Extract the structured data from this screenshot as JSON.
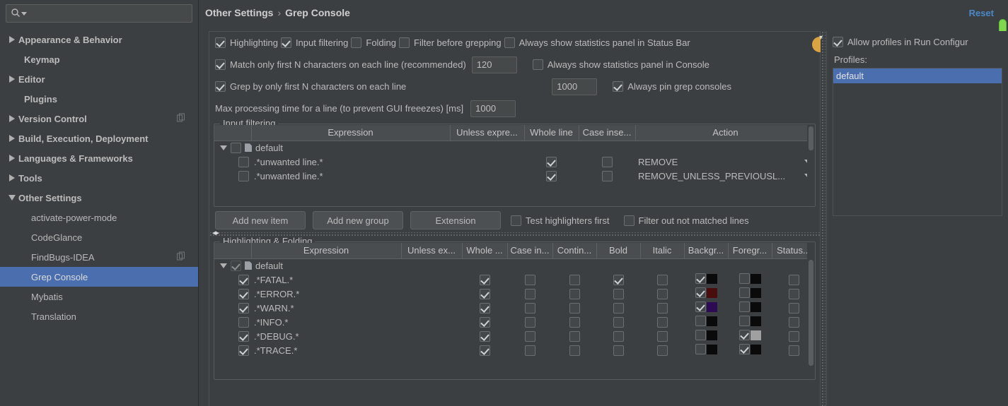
{
  "search": {
    "placeholder": "",
    "value": "",
    "icon": "search-icon"
  },
  "sidebar": {
    "items": [
      {
        "label": "Appearance & Behavior",
        "level": 1,
        "arrow": "collapsed",
        "selected": false,
        "badge": false
      },
      {
        "label": "Keymap",
        "level": 1,
        "arrow": "none",
        "selected": false,
        "badge": false
      },
      {
        "label": "Editor",
        "level": 1,
        "arrow": "collapsed",
        "selected": false,
        "badge": false
      },
      {
        "label": "Plugins",
        "level": 1,
        "arrow": "none",
        "selected": false,
        "badge": false
      },
      {
        "label": "Version Control",
        "level": 1,
        "arrow": "collapsed",
        "selected": false,
        "badge": true
      },
      {
        "label": "Build, Execution, Deployment",
        "level": 1,
        "arrow": "collapsed",
        "selected": false,
        "badge": false
      },
      {
        "label": "Languages & Frameworks",
        "level": 1,
        "arrow": "collapsed",
        "selected": false,
        "badge": false
      },
      {
        "label": "Tools",
        "level": 1,
        "arrow": "collapsed",
        "selected": false,
        "badge": false
      },
      {
        "label": "Other Settings",
        "level": 1,
        "arrow": "expanded",
        "selected": false,
        "badge": false
      },
      {
        "label": "activate-power-mode",
        "level": 2,
        "arrow": "none",
        "selected": false,
        "badge": false
      },
      {
        "label": "CodeGlance",
        "level": 2,
        "arrow": "none",
        "selected": false,
        "badge": false
      },
      {
        "label": "FindBugs-IDEA",
        "level": 2,
        "arrow": "none",
        "selected": false,
        "badge": true
      },
      {
        "label": "Grep Console",
        "level": 2,
        "arrow": "none",
        "selected": true,
        "badge": false
      },
      {
        "label": "Mybatis",
        "level": 2,
        "arrow": "none",
        "selected": false,
        "badge": false
      },
      {
        "label": "Translation",
        "level": 2,
        "arrow": "none",
        "selected": false,
        "badge": false
      }
    ]
  },
  "header": {
    "breadcrumb_parent": "Other Settings",
    "breadcrumb_sep": "›",
    "breadcrumb_current": "Grep Console",
    "reset_label": "Reset"
  },
  "options": {
    "row1": [
      {
        "label": "Highlighting",
        "checked": true
      },
      {
        "label": "Input filtering",
        "checked": true
      },
      {
        "label": "Folding",
        "checked": false
      },
      {
        "label": "Filter before grepping",
        "checked": false
      },
      {
        "label": "Always show statistics panel in Status Bar",
        "checked": false
      }
    ],
    "row2": {
      "label": "Match only first N characters on each line (recommended)",
      "checked": true,
      "value": "120",
      "right_label": "Always show statistics panel in Console",
      "right_checked": false
    },
    "row3": {
      "label": "Grep by only first N characters on each line",
      "checked": true,
      "value": "1000",
      "right_label": "Always pin grep consoles",
      "right_checked": true
    },
    "row4": {
      "label": "Max processing time for a line (to prevent GUI freeezes) [ms]",
      "value": "1000"
    }
  },
  "input_filtering": {
    "title": "Input filtering",
    "columns": [
      "",
      "Expression",
      "Unless expre...",
      "Whole line",
      "Case inse...",
      "Action"
    ],
    "group": {
      "label": "default",
      "checked": false,
      "expanded": true
    },
    "rows": [
      {
        "expression": ".*unwanted line.*",
        "enabled": false,
        "unless": false,
        "whole_line": true,
        "case_insensitive": false,
        "action": "REMOVE"
      },
      {
        "expression": ".*unwanted line.*",
        "enabled": false,
        "unless": false,
        "whole_line": true,
        "case_insensitive": false,
        "action": "REMOVE_UNLESS_PREVIOUSL..."
      }
    ],
    "buttons": [
      "Add new item",
      "Add new group",
      "Extension"
    ],
    "checkboxes": [
      {
        "label": "Test highlighters first",
        "checked": false
      },
      {
        "label": "Filter out not matched lines",
        "checked": false
      }
    ]
  },
  "highlighting": {
    "title": "Highlighting & Folding",
    "columns": [
      "",
      "Expression",
      "Unless ex...",
      "Whole ...",
      "Case in...",
      "Contin...",
      "Bold",
      "Italic",
      "Backgr...",
      "Foregr...",
      "Status..."
    ],
    "group": {
      "label": "default",
      "checked": true,
      "expanded": true
    },
    "rows": [
      {
        "expression": ".*FATAL.*",
        "enabled": true,
        "unless": false,
        "whole": true,
        "case_in": false,
        "contin": false,
        "bold": true,
        "italic": false,
        "bg_checked": true,
        "bg_color": "#0a0a0a",
        "fg_checked": false,
        "fg_color": "#0a0a0a",
        "status": false
      },
      {
        "expression": ".*ERROR.*",
        "enabled": true,
        "unless": false,
        "whole": true,
        "case_in": false,
        "contin": false,
        "bold": false,
        "italic": false,
        "bg_checked": true,
        "bg_color": "#4a0d0d",
        "fg_checked": false,
        "fg_color": "#0a0a0a",
        "status": false
      },
      {
        "expression": ".*WARN.*",
        "enabled": true,
        "unless": false,
        "whole": true,
        "case_in": false,
        "contin": false,
        "bold": false,
        "italic": false,
        "bg_checked": true,
        "bg_color": "#2c0a54",
        "fg_checked": false,
        "fg_color": "#0a0a0a",
        "status": false
      },
      {
        "expression": ".*INFO.*",
        "enabled": false,
        "unless": false,
        "whole": true,
        "case_in": false,
        "contin": false,
        "bold": false,
        "italic": false,
        "bg_checked": false,
        "bg_color": "#0a0a0a",
        "fg_checked": false,
        "fg_color": "#0a0a0a",
        "status": false
      },
      {
        "expression": ".*DEBUG.*",
        "enabled": true,
        "unless": false,
        "whole": true,
        "case_in": false,
        "contin": false,
        "bold": false,
        "italic": false,
        "bg_checked": false,
        "bg_color": "#0a0a0a",
        "fg_checked": true,
        "fg_color": "#a0a0a0",
        "status": false
      },
      {
        "expression": ".*TRACE.*",
        "enabled": true,
        "unless": false,
        "whole": true,
        "case_in": false,
        "contin": false,
        "bold": false,
        "italic": false,
        "bg_checked": false,
        "bg_color": "#0a0a0a",
        "fg_checked": true,
        "fg_color": "#0a0a0a",
        "status": false
      }
    ]
  },
  "right_panel": {
    "allow_profiles_label": "Allow profiles in Run Configur",
    "allow_profiles_checked": true,
    "profiles_label": "Profiles:",
    "profiles": [
      {
        "label": "default",
        "selected": true
      }
    ]
  },
  "colors": {
    "accent_selection": "#4b6eaf",
    "link": "#4a88c7",
    "bg": "#3c3f41",
    "scroll_thumb_green": "#7ed94f",
    "marker_orange": "#d9a441"
  }
}
